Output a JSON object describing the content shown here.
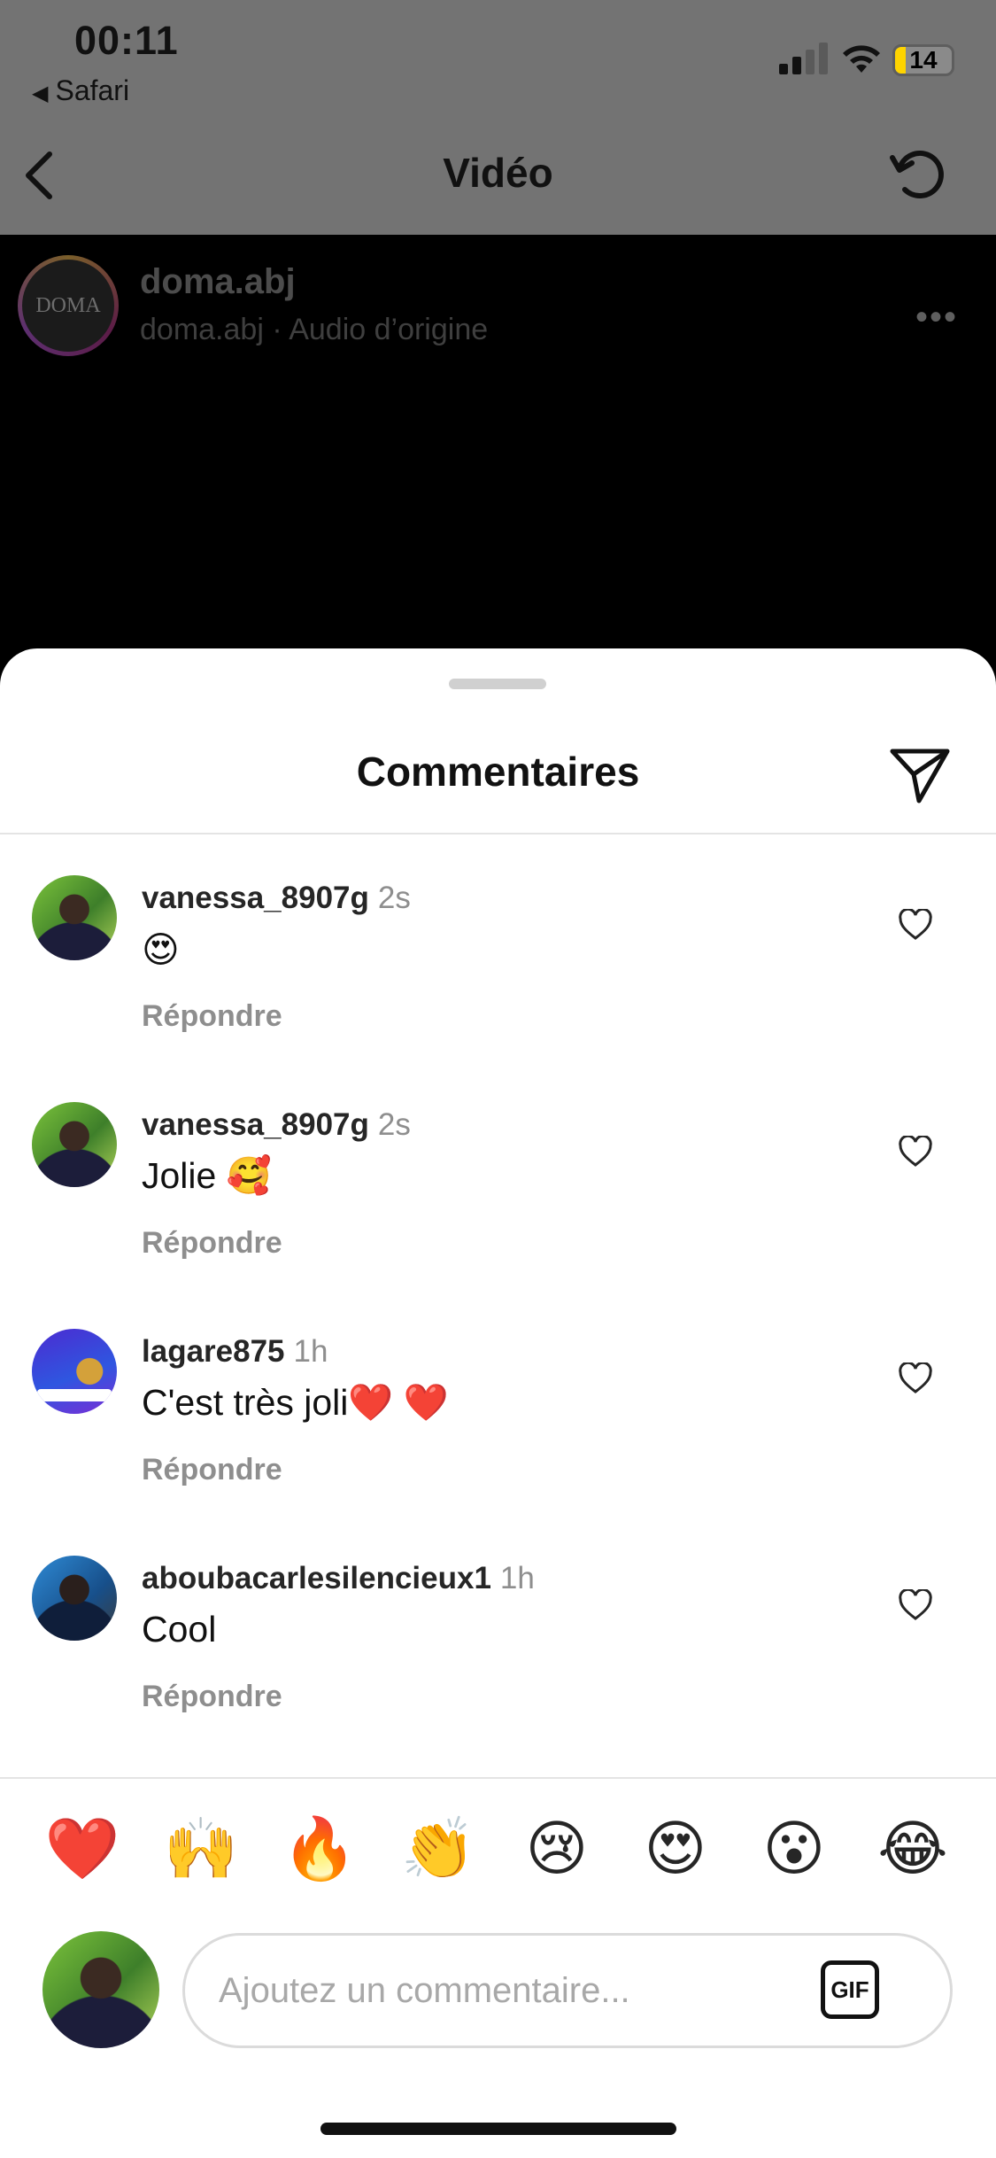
{
  "status": {
    "time": "00:11",
    "back_app": "Safari",
    "battery": "14"
  },
  "nav": {
    "title": "Vidéo"
  },
  "video": {
    "avatar_text": "DOMA",
    "username": "doma.abj",
    "subtitle": "doma.abj · Audio d’origine"
  },
  "sheet": {
    "title": "Commentaires"
  },
  "comments": [
    {
      "user": "vanessa_8907g",
      "time": "2s",
      "text": "😍",
      "reply": "Répondre"
    },
    {
      "user": "vanessa_8907g",
      "time": "2s",
      "text": "Jolie 🥰",
      "reply": "Répondre"
    },
    {
      "user": "lagare875",
      "time": "1h",
      "text": "C'est très joli❤️ ❤️",
      "reply": "Répondre"
    },
    {
      "user": "aboubacarlesilencieux1",
      "time": "1h",
      "text": "Cool",
      "reply": "Répondre"
    }
  ],
  "emojis": [
    "❤️",
    "🙌",
    "🔥",
    "👏",
    "😢",
    "😍",
    "😮",
    "😂"
  ],
  "composer": {
    "placeholder": "Ajoutez un commentaire...",
    "gif_label": "GIF"
  },
  "colors": {
    "overlay": "#737373",
    "muted": "#8e8e8e",
    "text": "#262626"
  }
}
